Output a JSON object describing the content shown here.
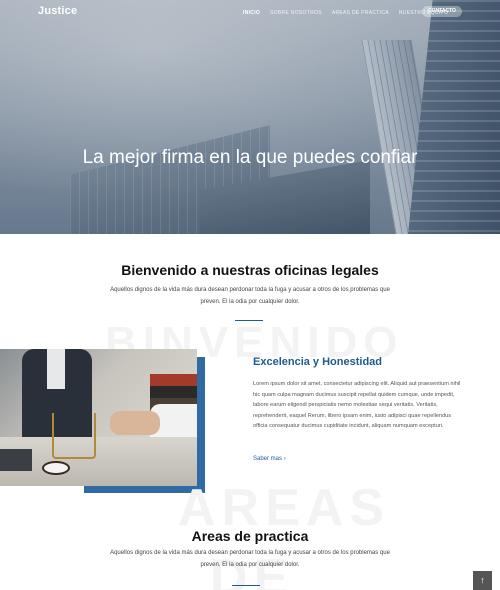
{
  "nav": {
    "logo": "Justice",
    "items": [
      "INICIO",
      "SOBRE NOSOTROS",
      "AREAS DE PRACTICA",
      "NUESTRO EQUIPO"
    ],
    "contact": "CONTACTO"
  },
  "hero": {
    "title": "La mejor firma en la que puedes confiar"
  },
  "welcome": {
    "title": "Bienvenido a nuestras oficinas legales",
    "text": "Aquellos dignos de la vida más dura desean perdonar toda la fuga y acusar a otros de los problemas que preven. El la odia por cualquier dolor.",
    "watermark": "BINVENIDO"
  },
  "about": {
    "title": "Excelencia y Honestidad",
    "text": "Lorem ipsum dolor sit amet, consectetur adipiscing elit. Aliquid aut praesentium nihil hic quam culpa magnam ducimus suscipit repellat quidem cumque, unde impedit, labore earum eligendi perspiciatis nemo molestiae sequi veritatis. Veritatis, reprehenderit, eaquel Rerum, libero ipsam enim, iusto adipisci quae repellendus officia consequatur ducimus cupiditate incidunt, aliquam numquam excepturi.",
    "more": "Saber mas",
    "more_icon": "chevron-right-icon"
  },
  "areas": {
    "title": "Areas de practica",
    "text": "Aquellos dignos de la vida más dura desean perdonar toda la fuga y acusar a otros de los problemas que preven. El la odia por cualquier dolor.",
    "watermark": "AREAS",
    "watermark2": "DE"
  },
  "scroll_top": {
    "icon": "arrow-up-icon",
    "glyph": "↑"
  },
  "colors": {
    "accent": "#1f5a90",
    "accent_block": "#2f6aa3"
  }
}
